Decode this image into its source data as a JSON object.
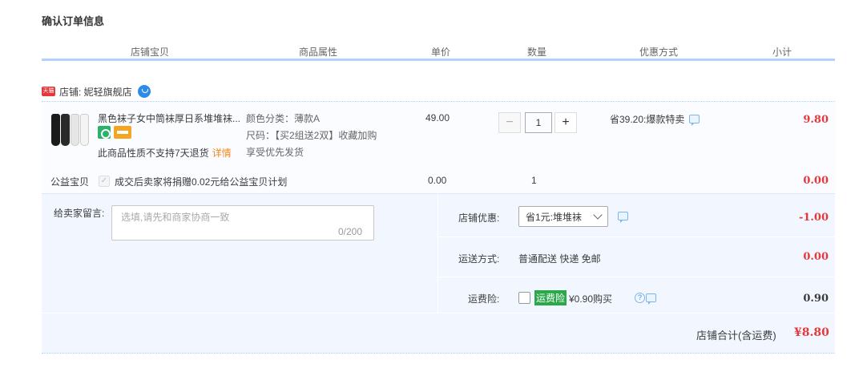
{
  "page_title": "确认订单信息",
  "header": {
    "columns": [
      "店铺宝贝",
      "商品属性",
      "单价",
      "数量",
      "优惠方式",
      "小计"
    ]
  },
  "shop": {
    "badge": "天猫",
    "label": "店铺: 妮轻旗舰店"
  },
  "item": {
    "title": "黑色袜子女中筒袜厚日系堆堆袜...",
    "no_return_text": "此商品性质不支持7天退货",
    "detail_link": "详情",
    "attr_color": "颜色分类：薄款A",
    "attr_size": "尺码：【买2组送2双】收藏加购",
    "attr_priority": "享受优先发货",
    "unit_price": "49.00",
    "quantity": "1",
    "minus": "−",
    "plus": "+",
    "promo": "省39.20:爆款特卖",
    "subtotal": "9.80"
  },
  "charity": {
    "label": "公益宝贝",
    "text": "成交后卖家将捐赠0.02元给公益宝贝计划",
    "price": "0.00",
    "qty": "1",
    "subtotal": "0.00"
  },
  "message": {
    "label": "给卖家留言:",
    "placeholder": "选填,请先和商家协商一致",
    "counter": "0/200"
  },
  "shop_discount": {
    "label": "店铺优惠:",
    "selected": "省1元:堆堆袜",
    "amount": "-1.00"
  },
  "shipping": {
    "label": "运送方式:",
    "value": "普通配送 快递 免邮",
    "amount": "0.00"
  },
  "insurance": {
    "label": "运费险:",
    "tag": "运费险",
    "text": "¥0.90购买",
    "amount": "0.90"
  },
  "total": {
    "label": "店铺合计(含运费)",
    "value": "¥8.80"
  }
}
